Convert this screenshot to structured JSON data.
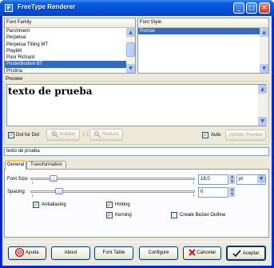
{
  "window": {
    "title": "FreeType Renderer",
    "controls": {
      "minimize": "_",
      "maximize": "□",
      "close": "✕"
    }
  },
  "font_family": {
    "header": "Font Family",
    "items": [
      "Parchment",
      "Perpetua",
      "Perpetua Titling MT",
      "Playbill",
      "Poor Richard",
      "PosterBodoni BT",
      "Pristina"
    ],
    "selected": "PosterBodoni BT"
  },
  "font_style": {
    "header": "Font Style",
    "items": [
      "Roman"
    ],
    "selected": "Roman"
  },
  "preview": {
    "label": "Preview",
    "text": "texto de prueba"
  },
  "preview_toolbar": {
    "dot_for_dot": {
      "label": "Dot for Dot",
      "checked": true
    },
    "zoom_in": "Ampliar",
    "ratio": "1:1",
    "zoom_out": "Reducir",
    "auto": {
      "label": "Auto",
      "checked": true
    },
    "update_preview": "Update Preview"
  },
  "sample_text": {
    "value": "texto de prueba"
  },
  "tabs": {
    "general": "General",
    "transformation": "Transformation",
    "active": "General"
  },
  "general": {
    "font_size": {
      "label": "Font Size:",
      "value": "18,0",
      "unit": "pt",
      "slider_fraction": 0.12
    },
    "spacing": {
      "label": "Spacing:",
      "value": "0",
      "slider_fraction": 0.16
    },
    "antialiasing": {
      "label": "Antialiasing",
      "checked": true
    },
    "hinting": {
      "label": "Hinting",
      "checked": true
    },
    "kerning": {
      "label": "Kerning",
      "checked": true
    },
    "bezier": {
      "label": "Create Bezier Outline",
      "checked": false
    }
  },
  "buttons": {
    "help": "Ayuda",
    "about": "About",
    "font_table": "Font Table",
    "configure": "Configure",
    "cancel": "Cancelar",
    "accept": "Aceptar"
  },
  "colors": {
    "titlebar": "#0551d8",
    "selection": "#316ac5",
    "face": "#ece9d8",
    "check": "#21a121"
  },
  "icons": [
    "app-icon",
    "zoom-in-icon",
    "zoom-out-icon",
    "help-icon",
    "cancel-icon",
    "accept-icon"
  ]
}
